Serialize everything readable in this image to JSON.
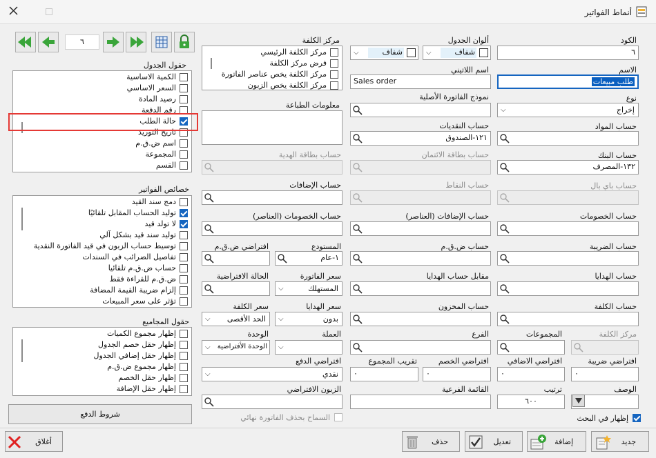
{
  "window": {
    "title": "أنماط الفواتير"
  },
  "toolbar": {
    "record_number": "٦"
  },
  "form": {
    "code_label": "الكود",
    "code_value": "٦",
    "name_label": "الاسم",
    "name_value": "طلب مبيعات",
    "type_label": "نوع",
    "type_value": "إخراج",
    "materials_account_label": "حساب المواد",
    "bank_account_label": "حساب البنك",
    "bank_account_value": "١٣٢-المصرف",
    "paypal_account_label": "حساب باي بال",
    "discounts_account_label": "حساب الخصومات",
    "tax_account_label": "حساب الضريبة",
    "gifts_account_label": "حساب الهدايا",
    "cost_account_label": "حساب الكلفة",
    "cost_center_label": "مركز الكلفة",
    "groups_label": "المجموعات",
    "default_tax_label": "افتراضي ضريبة",
    "default_tax_value": "٠",
    "default_additions_label": "افتراضي الاضافي",
    "default_additions_value": "٠",
    "description_label": "الوصف",
    "order_label": "ترتيب",
    "order_value": "٦٠٠",
    "show_in_search_label": "إظهار في البحث",
    "table_colors_label": "ألوان الجدول",
    "table_color_value": "شفاف",
    "color2_value": "شفاف",
    "latin_name_label": "اسم اللاتيني",
    "latin_name_value": "Sales order",
    "original_invoice_form_label": "نموذج الفاتورة الأصلية",
    "cash_account_label": "حساب النقديات",
    "cash_account_value": "١٢١-الصندوق",
    "credit_card_account_label": "حساب بطاقة الائتمان",
    "points_account_label": "حساب النقاط",
    "additions_items_account_label": "حساب الإضافات (العناصر)",
    "vat_account_label": "حساب ض.ق.م",
    "gifts_counter_account_label": "مقابل حساب الهدايا",
    "inventory_account_label": "حساب المخزون",
    "branch_label": "الفرع",
    "default_discount_label": "افتراضي الخصم",
    "default_discount_value": "٠",
    "round_total_label": "تقريب المجموع",
    "round_total_value": "٠",
    "sub_list_label": "القائمة الفرعية",
    "cost_center_box_label": "مركز الكلفة",
    "cost_center_options": [
      "مركز الكلفة الرئيسي",
      "فرض مركز الكلفة",
      "مركز الكلفة يخص عناصر الفاتورة",
      "مركز الكلفة يخص الزبون"
    ],
    "printing_info_label": "معلومات الطباعة",
    "gift_card_account_label": "حساب بطاقة الهدية",
    "additions_account_label": "حساب الإضافات",
    "discounts_items_account_label": "حساب الخصومات (العناصر)",
    "warehouse_label": "المستودع",
    "warehouse_value": "١-عام",
    "default_vat_label": "افتراضي ض.ق.م",
    "invoice_price_label": "سعر الفاتورة",
    "invoice_price_value": "المستهلك",
    "default_state_label": "الحالة الافتراضية",
    "gifts_price_label": "سعر الهدايا",
    "gifts_price_value": "بدون",
    "cost_price_label": "سعر الكلفة",
    "cost_price_value": "الحد الأقصى",
    "currency_label": "العملة",
    "unit_label": "الوحدة",
    "unit_value": "الوحدة الأفتراضية",
    "default_payment_label": "افتراضي الدفع",
    "default_payment_value": "نقدي",
    "default_customer_label": "الزبون الافتراضي",
    "allow_delete_final_label": "السماح بحذف الفاتورة نهائي"
  },
  "table_fields": {
    "title": "حقول الجدول",
    "items": [
      {
        "label": "الكمية الاساسية",
        "checked": false
      },
      {
        "label": "السعر الاساسي",
        "checked": false
      },
      {
        "label": "رصيد المادة",
        "checked": false
      },
      {
        "label": "رقم الدفعة",
        "checked": false
      },
      {
        "label": "حالة الطلب",
        "checked": true
      },
      {
        "label": "تاريخ التوريد",
        "checked": false
      },
      {
        "label": "اسم ض.ق.م",
        "checked": false
      },
      {
        "label": "المجموعة",
        "checked": false
      },
      {
        "label": "القسم",
        "checked": false
      }
    ]
  },
  "invoice_props": {
    "title": "خصائص الفواتير",
    "items": [
      {
        "label": "دمج سند القيد",
        "checked": false
      },
      {
        "label": "توليد الحساب المقابل تلقائيًا",
        "checked": true
      },
      {
        "label": "لا تولد قيد",
        "checked": true
      },
      {
        "label": "توليد سند قيد بشكل آلي",
        "checked": false
      },
      {
        "label": "توسيط حساب الزبون في قيد الفاتورة النقدية",
        "checked": false
      },
      {
        "label": "تفاصيل الضرائب في السندات",
        "checked": false
      },
      {
        "label": "حساب ض.ق.م تلقائيا",
        "checked": false
      },
      {
        "label": "ض.ق.م للقراءة فقط",
        "checked": false
      },
      {
        "label": "إلزام ضريبة القيمة المضافة",
        "checked": false
      },
      {
        "label": "تؤثر على سعر المبيعات",
        "checked": false
      }
    ]
  },
  "totals_fields": {
    "title": "حقول المجاميع",
    "items": [
      {
        "label": "إظهار مجموع الكميات",
        "checked": false
      },
      {
        "label": "إظهار حقل خصم الجدول",
        "checked": false
      },
      {
        "label": "إظهار حقل إضافي الجدول",
        "checked": false
      },
      {
        "label": "إظهار مجموع ض.ق.م",
        "checked": false
      },
      {
        "label": "إظهار حقل الخصم",
        "checked": false
      },
      {
        "label": "إظهار حقل الإضافة",
        "checked": false
      }
    ]
  },
  "payment_terms_label": "شروط الدفع",
  "buttons": {
    "new": "جديد",
    "add": "إضافة",
    "edit": "تعديل",
    "delete": "حذف",
    "close": "أغلاق"
  },
  "colors": {
    "highlight": "#e53935",
    "check": "#1565c0",
    "toolbar_green": "#3aa53a",
    "accent": "#1565c0"
  }
}
